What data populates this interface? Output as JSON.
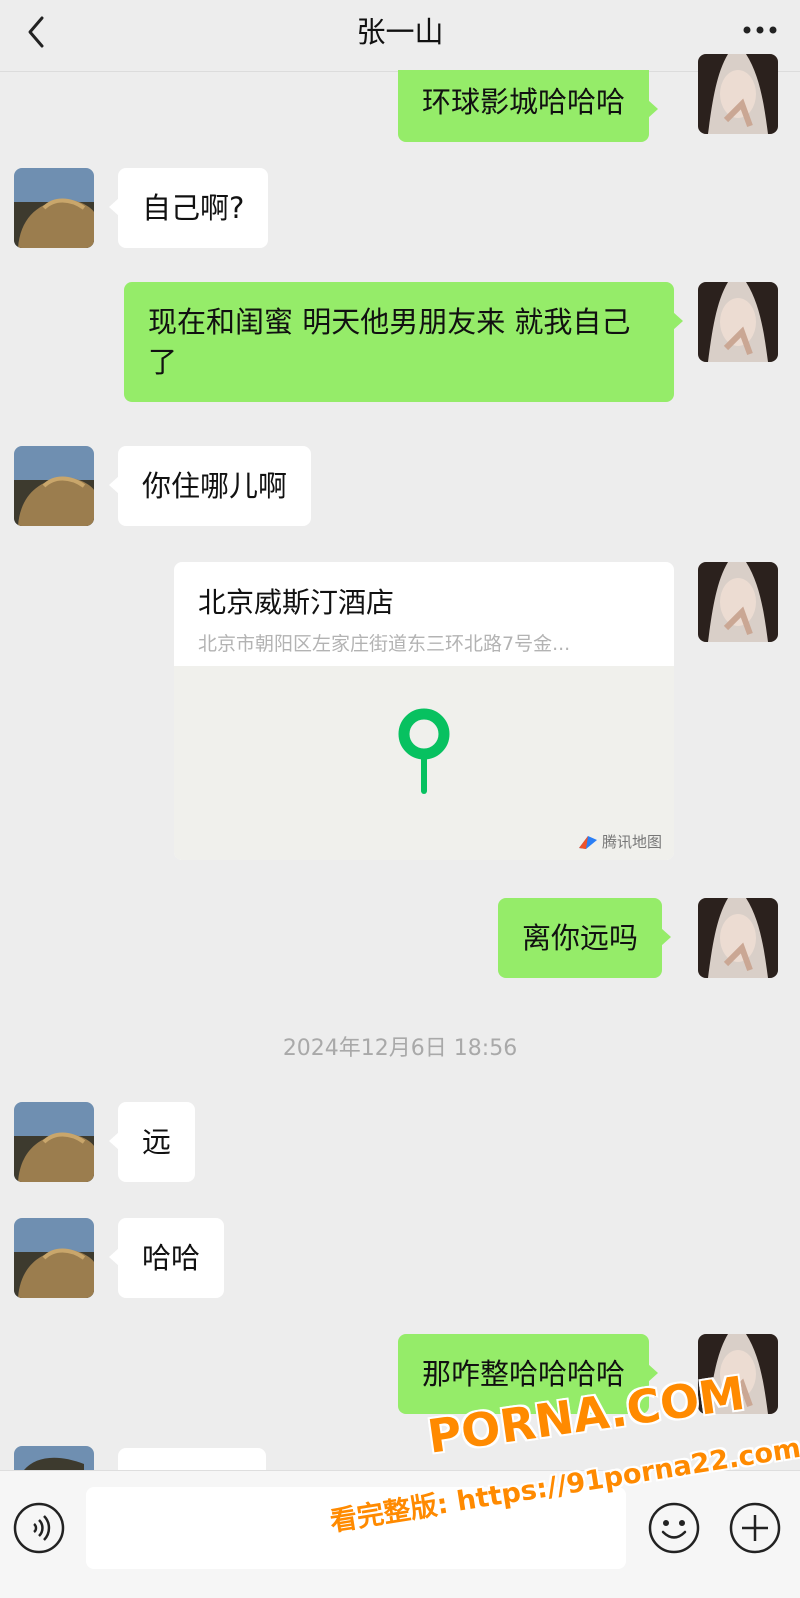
{
  "header": {
    "title": "张一山",
    "back_icon": "chevron-left-icon",
    "more_icon": "ellipsis-icon"
  },
  "messages": [
    {
      "side": "out",
      "text": "环球影城哈哈哈"
    },
    {
      "side": "in",
      "text": "自己啊?"
    },
    {
      "side": "out",
      "text": "现在和闺蜜 明天他男朋友来 就我自己了"
    },
    {
      "side": "in",
      "text": "你住哪儿啊"
    },
    {
      "side": "out",
      "type": "location",
      "name": "北京威斯汀酒店",
      "address": "北京市朝阳区左家庄街道东三环北路7号金...",
      "map_brand": "腾讯地图"
    },
    {
      "side": "out",
      "text": "离你远吗"
    },
    {
      "side": "in",
      "text": "远"
    },
    {
      "side": "in",
      "text": "哈哈"
    },
    {
      "side": "out",
      "text": "那咋整哈哈哈哈"
    }
  ],
  "timestamp": "2024年12月6日 18:56",
  "footer": {
    "voice_icon": "voice-icon",
    "emoji_icon": "emoji-icon",
    "plus_icon": "plus-icon",
    "input_value": ""
  },
  "watermark": {
    "brand": "PORNA.COM",
    "tagline": "看完整版: https://91porna22.com"
  },
  "colors": {
    "background": "#ededed",
    "outgoing_bubble": "#95ec69",
    "incoming_bubble": "#ffffff",
    "pin": "#07c160",
    "watermark": "#ff8a00"
  }
}
